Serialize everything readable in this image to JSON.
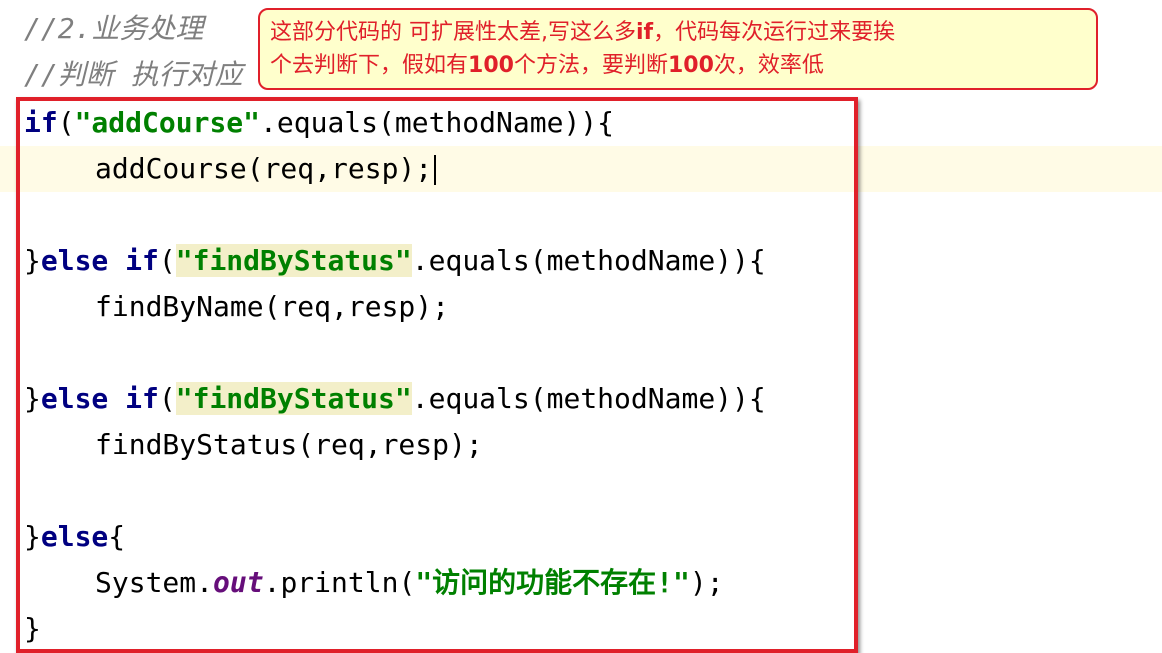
{
  "comments": {
    "line1": "//2.业务处理",
    "line2": "//判断 执行对应"
  },
  "callout": {
    "line1_part1": "这部分代码的 可扩展性太差,写这么多",
    "line1_bold": "if",
    "line1_part2": "，代码每次运行过来要挨",
    "line2_part1": "个去判断下，假如有",
    "line2_bold1": "100",
    "line2_part2": "个方法，要判断",
    "line2_bold2": "100",
    "line2_part3": "次，效率低"
  },
  "code": {
    "kw_if": "if",
    "kw_else": "else",
    "kw_else_if": "else if",
    "brace_open": "{",
    "brace_close": "}",
    "str_add": "\"addCourse\"",
    "str_find_status": "\"findByStatus\"",
    "equals_call": ".equals(methodName)){",
    "paren_open": "(",
    "call_add": "addCourse(req,resp);",
    "call_find_name": "findByName(req,resp);",
    "call_find_status": "findByStatus(req,resp);",
    "system": "System.",
    "out": "out",
    "println_open": ".println(",
    "str_msg": "\"访问的功能不存在!\"",
    "println_close": ");"
  },
  "colors": {
    "annotation_red": "#e0202a",
    "callout_bg": "#ffffcc",
    "keyword": "#000080",
    "string": "#008000",
    "comment": "#7f7f7f",
    "field": "#660e7a"
  }
}
